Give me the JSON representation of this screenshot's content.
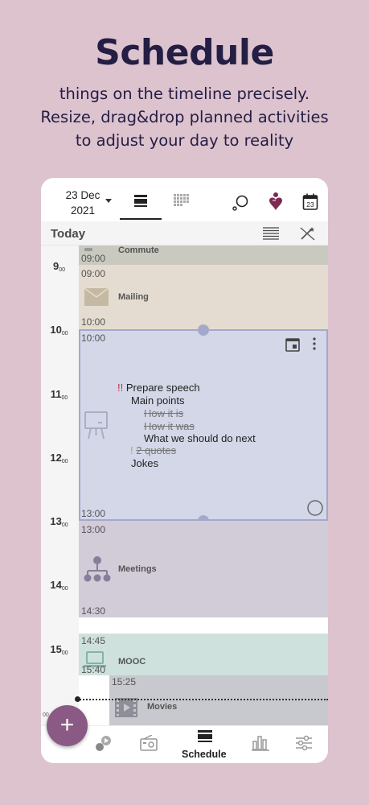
{
  "promo": {
    "title": "Schedule",
    "line1": "things on the timeline precisely.",
    "line2": "Resize, drag&drop planned activities",
    "line3": "to adjust your day to reality"
  },
  "header": {
    "date_day": "23 Dec",
    "date_year": "2021",
    "calendar_day": "23"
  },
  "today_label": "Today",
  "hours": [
    {
      "h": "9",
      "m": "00"
    },
    {
      "h": "10",
      "m": "00"
    },
    {
      "h": "11",
      "m": "00"
    },
    {
      "h": "12",
      "m": "00"
    },
    {
      "h": "13",
      "m": "00"
    },
    {
      "h": "14",
      "m": "00"
    },
    {
      "h": "15",
      "m": "00"
    }
  ],
  "activities": {
    "commute": {
      "title": "Commute",
      "start": "09:00"
    },
    "mailing": {
      "title": "Mailing",
      "start": "09:00",
      "end": "10:00"
    },
    "speech": {
      "start": "10:00",
      "end": "13:00",
      "title_mark": "!!",
      "title": "Prepare speech",
      "l1": "Main points",
      "l2": "How it is",
      "l3": "How it was",
      "l4": "What we should do next",
      "l5_mark": "!",
      "l5": "2 quotes",
      "l6": "Jokes"
    },
    "meetings": {
      "title": "Meetings",
      "start": "13:00",
      "end": "14:30"
    },
    "mooc": {
      "title": "MOOC",
      "start": "14:45",
      "end": "15:40"
    },
    "movies": {
      "title": "Movies",
      "start": "15:25",
      "gutter_time": "00"
    }
  },
  "bottom_nav": {
    "active_label": "Schedule"
  },
  "colors": {
    "background": "#dcc3ce",
    "accent": "#8a5a84",
    "selected_border": "#a3a9cc",
    "heart": "#7b2a52"
  }
}
